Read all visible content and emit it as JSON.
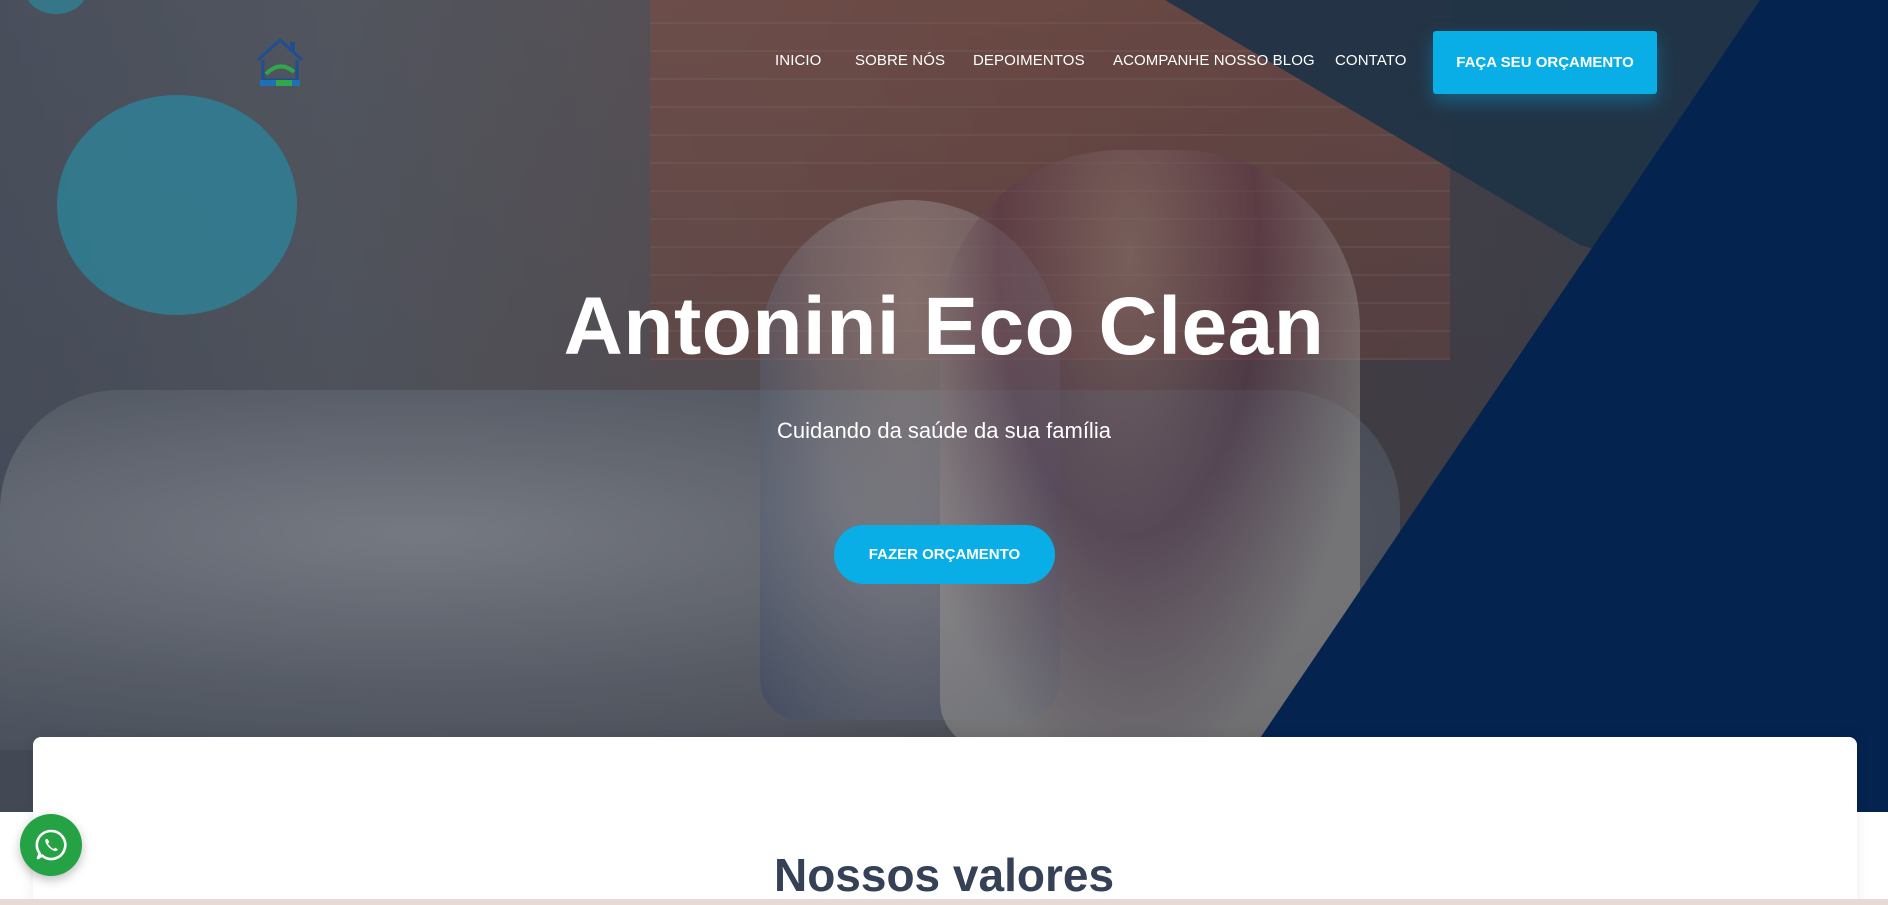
{
  "header": {
    "logo_icon": "house-logo-icon",
    "nav": [
      {
        "label": "INICIO"
      },
      {
        "label": "SOBRE NÓS"
      },
      {
        "label": "DEPOIMENTOS"
      },
      {
        "label": "ACOMPANHE NOSSO BLOG"
      },
      {
        "label": "CONTATO"
      }
    ],
    "cta_label": "FAÇA SEU ORÇAMENTO"
  },
  "hero": {
    "title": "Antonini Eco Clean",
    "subtitle": "Cuidando da saúde da sua família",
    "button_label": "FAZER ORÇAMENTO"
  },
  "values": {
    "title": "Nossos valores"
  },
  "floating": {
    "whatsapp_icon": "whatsapp-icon"
  },
  "colors": {
    "accent": "#0aaee6",
    "navy": "#04234f",
    "dark_teal": "#1e3347",
    "circle": "#2f7f94",
    "heading": "#344157",
    "whatsapp": "#25a244"
  }
}
